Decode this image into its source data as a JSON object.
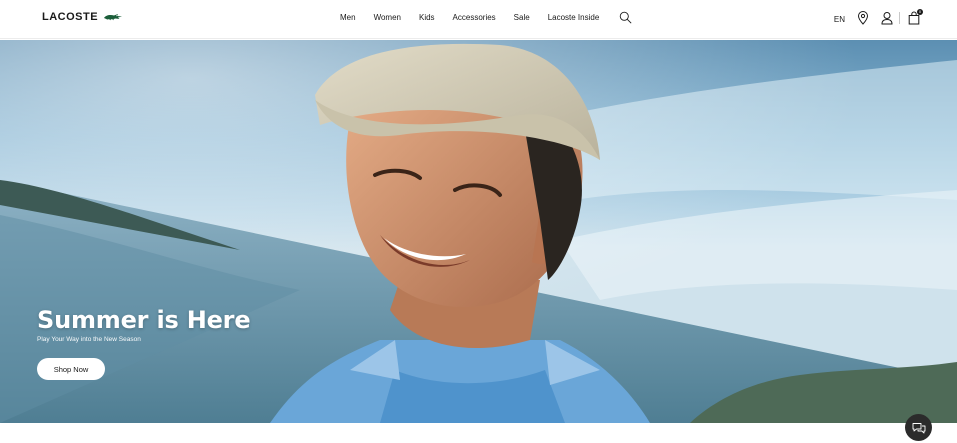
{
  "brand": {
    "name": "LACOSTE",
    "logo_icon": "crocodile-icon",
    "accent_color": "#1b5e3a"
  },
  "nav": {
    "items": [
      {
        "label": "Men"
      },
      {
        "label": "Women"
      },
      {
        "label": "Kids"
      },
      {
        "label": "Accessories"
      },
      {
        "label": "Sale"
      },
      {
        "label": "Lacoste Inside"
      }
    ],
    "search_icon": "search-icon"
  },
  "utilities": {
    "language": "EN",
    "store_icon": "location-pin-icon",
    "account_icon": "user-icon",
    "bag_icon": "shopping-bag-icon",
    "bag_count": "0"
  },
  "hero": {
    "title": "Summer is Here",
    "subtitle": "Play Your Way into the New Season",
    "cta_label": "Shop Now"
  },
  "chat": {
    "icon": "chat-icon"
  }
}
